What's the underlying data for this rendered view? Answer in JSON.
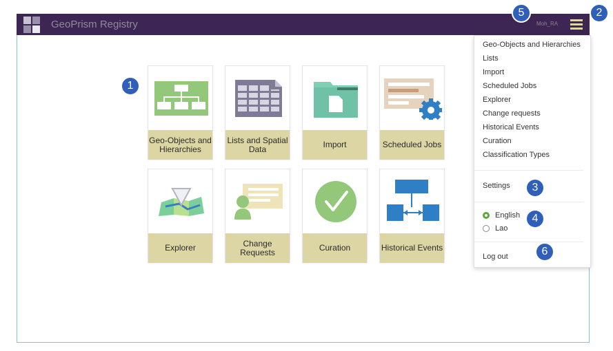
{
  "header": {
    "app_title": "GeoPrism Registry",
    "username": "Moh_RA",
    "menu_icon": "hamburger-menu-icon"
  },
  "tiles": [
    {
      "label": "Geo-Objects and Hierarchies",
      "icon": "hierarchy-icon"
    },
    {
      "label": "Lists and Spatial Data",
      "icon": "spreadsheet-icon"
    },
    {
      "label": "Import",
      "icon": "folder-document-icon"
    },
    {
      "label": "Scheduled Jobs",
      "icon": "gear-document-icon"
    },
    {
      "label": "Explorer",
      "icon": "map-icon"
    },
    {
      "label": "Change Requests",
      "icon": "person-document-icon"
    },
    {
      "label": "Curation",
      "icon": "checkmark-icon"
    },
    {
      "label": "Historical Events",
      "icon": "flowchart-icon"
    }
  ],
  "menu": {
    "items": [
      "Geo-Objects and Hierarchies",
      "Lists",
      "Import",
      "Scheduled Jobs",
      "Explorer",
      "Change requests",
      "Historical Events",
      "Curation",
      "Classification Types"
    ],
    "settings": "Settings",
    "languages": [
      {
        "label": "English",
        "selected": true
      },
      {
        "label": "Lao",
        "selected": false
      }
    ],
    "logout": "Log out"
  },
  "callouts": [
    "1",
    "2",
    "3",
    "4",
    "5",
    "6"
  ],
  "colors": {
    "topbar": "#3d2653",
    "tile_label_bg": "#dcd6a5",
    "callout": "#2f5fb8",
    "radio_selected": "#5aa83a"
  }
}
